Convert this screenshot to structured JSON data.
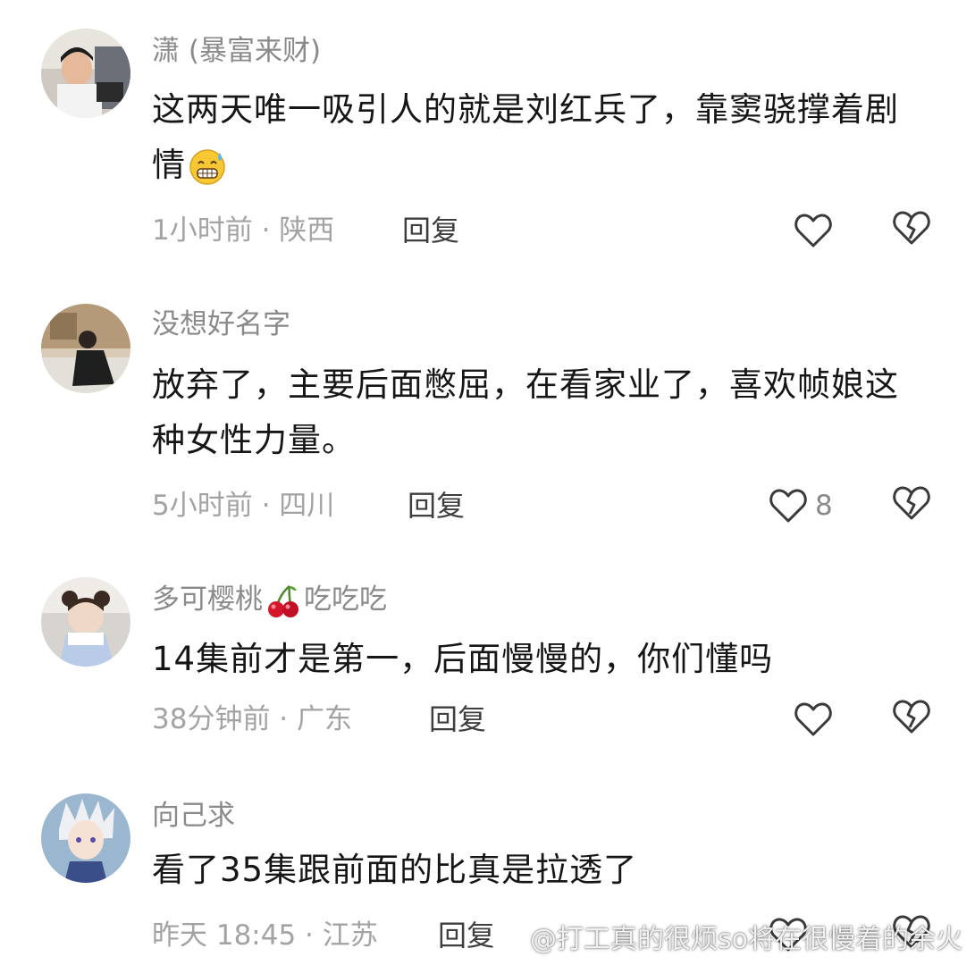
{
  "comments": [
    {
      "username": "潇 (暴富来财)",
      "text": "这两天唯一吸引人的就是刘红兵了，靠窦骁撑着剧情",
      "emoji": "sweat-grin-emoji",
      "meta": "1小时前 · 陕西",
      "reply_label": "回复",
      "like_count": "",
      "icons": {
        "like": "heart-outline-icon",
        "dislike": "broken-heart-icon"
      }
    },
    {
      "username": "没想好名字",
      "text": "放弃了，主要后面憋屈，在看家业了，喜欢帧娘这种女性力量。",
      "meta": "5小时前 · 四川",
      "reply_label": "回复",
      "like_count": "8",
      "icons": {
        "like": "heart-outline-icon",
        "dislike": "broken-heart-icon"
      }
    },
    {
      "username_prefix": "多可樱桃",
      "username_emoji": "cherry-emoji",
      "username_suffix": "吃吃吃",
      "text": "14集前才是第一，后面慢慢的，你们懂吗",
      "meta": "38分钟前 · 广东",
      "reply_label": "回复",
      "like_count": "",
      "icons": {
        "like": "heart-outline-icon",
        "dislike": "broken-heart-icon"
      }
    },
    {
      "username": "向己求",
      "text": "看了35集跟前面的比真是拉透了",
      "meta": "昨天 18:45 · 江苏",
      "reply_label": "回复",
      "like_count": "",
      "icons": {
        "like": "heart-outline-icon",
        "dislike": "broken-heart-icon"
      }
    }
  ],
  "watermark": {
    "text": "@打工真的很烦so将在很慢着的余火",
    "icon": "weibo-logo-icon"
  },
  "colors": {
    "username": "#8a8a8a",
    "body": "#161616",
    "meta": "#a3a3a3",
    "reply": "#3e3e3e",
    "icon_stroke": "#3a3a3a"
  }
}
